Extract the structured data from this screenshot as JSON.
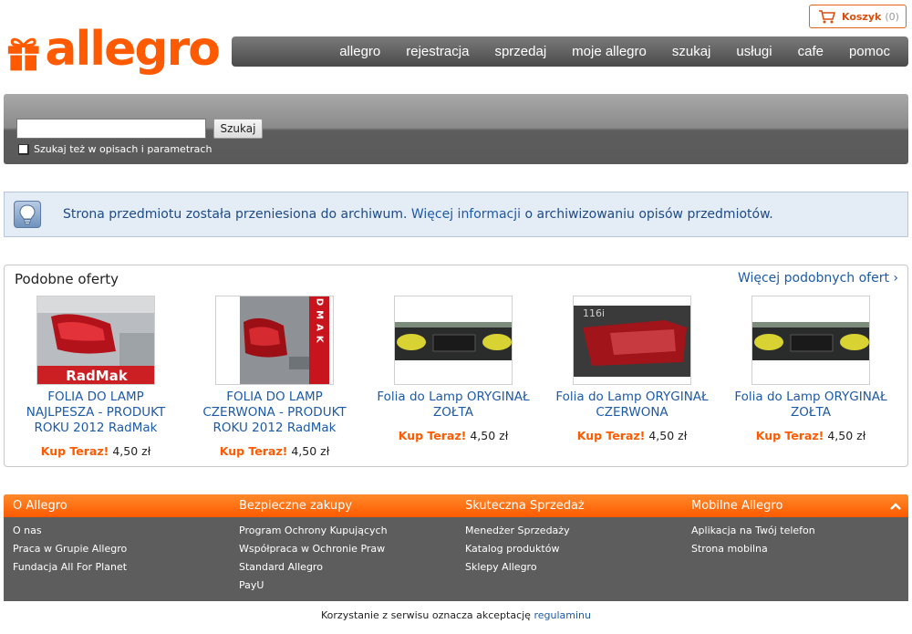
{
  "logo": {
    "text": "allegro"
  },
  "cart": {
    "label": "Koszyk",
    "count": "(0)"
  },
  "topnav": [
    "allegro",
    "rejestracja",
    "sprzedaj",
    "moje allegro",
    "szukaj",
    "usługi",
    "cafe",
    "pomoc"
  ],
  "search": {
    "value": "",
    "placeholder": "",
    "button": "Szukaj",
    "checkbox_label": "Szukaj też w opisach i parametrach",
    "checkbox_checked": false
  },
  "notice": {
    "before": "Strona przedmiotu została przeniesiona do archiwum.",
    "link": "Więcej informacji",
    "after": "o archiwizowaniu opisów przedmiotów."
  },
  "similar": {
    "title": "Podobne oferty",
    "more": "Więcej podobnych ofert ›",
    "items": [
      {
        "title": "FOLIA DO LAMP NAJLPESZA - PRODUKT ROKU 2012 RadMak",
        "buy": "Kup Teraz!",
        "price": "4,50 zł",
        "badge": "RadMak"
      },
      {
        "title": "FOLIA DO LAMP CZERWONA - PRODUKT ROKU 2012 RadMak",
        "buy": "Kup Teraz!",
        "price": "4,50 zł",
        "badge": "RADMAK"
      },
      {
        "title": "Folia do Lamp ORYGINAŁ ZOŁTA",
        "buy": "Kup Teraz!",
        "price": "4,50 zł"
      },
      {
        "title": "Folia do Lamp ORYGINAŁ CZERWONA",
        "buy": "Kup Teraz!",
        "price": "4,50 zł"
      },
      {
        "title": "Folia do Lamp ORYGINAŁ ZOŁTA",
        "buy": "Kup Teraz!",
        "price": "4,50 zł"
      }
    ]
  },
  "footer": {
    "columns": [
      {
        "title": "O Allegro",
        "links": [
          "O nas",
          "Praca w Grupie Allegro",
          "Fundacja All For Planet"
        ]
      },
      {
        "title": "Bezpieczne zakupy",
        "links": [
          "Program Ochrony Kupujących",
          "Współpraca w Ochronie Praw",
          "Standard Allegro",
          "PayU"
        ]
      },
      {
        "title": "Skuteczna Sprzedaż",
        "links": [
          "Menedżer Sprzedaży",
          "Katalog produktów",
          "Sklepy Allegro"
        ]
      },
      {
        "title": "Mobilne Allegro",
        "links": [
          "Aplikacja na Twój telefon",
          "Strona mobilna"
        ]
      }
    ]
  },
  "legal": {
    "text": "Korzystanie z serwisu oznacza akceptację",
    "link": "regulaminu"
  },
  "colors": {
    "brand": "#ff5a00",
    "link": "#1d5aa8",
    "nav": "#5d5d5d",
    "notice_bg": "#e4ecf6"
  }
}
